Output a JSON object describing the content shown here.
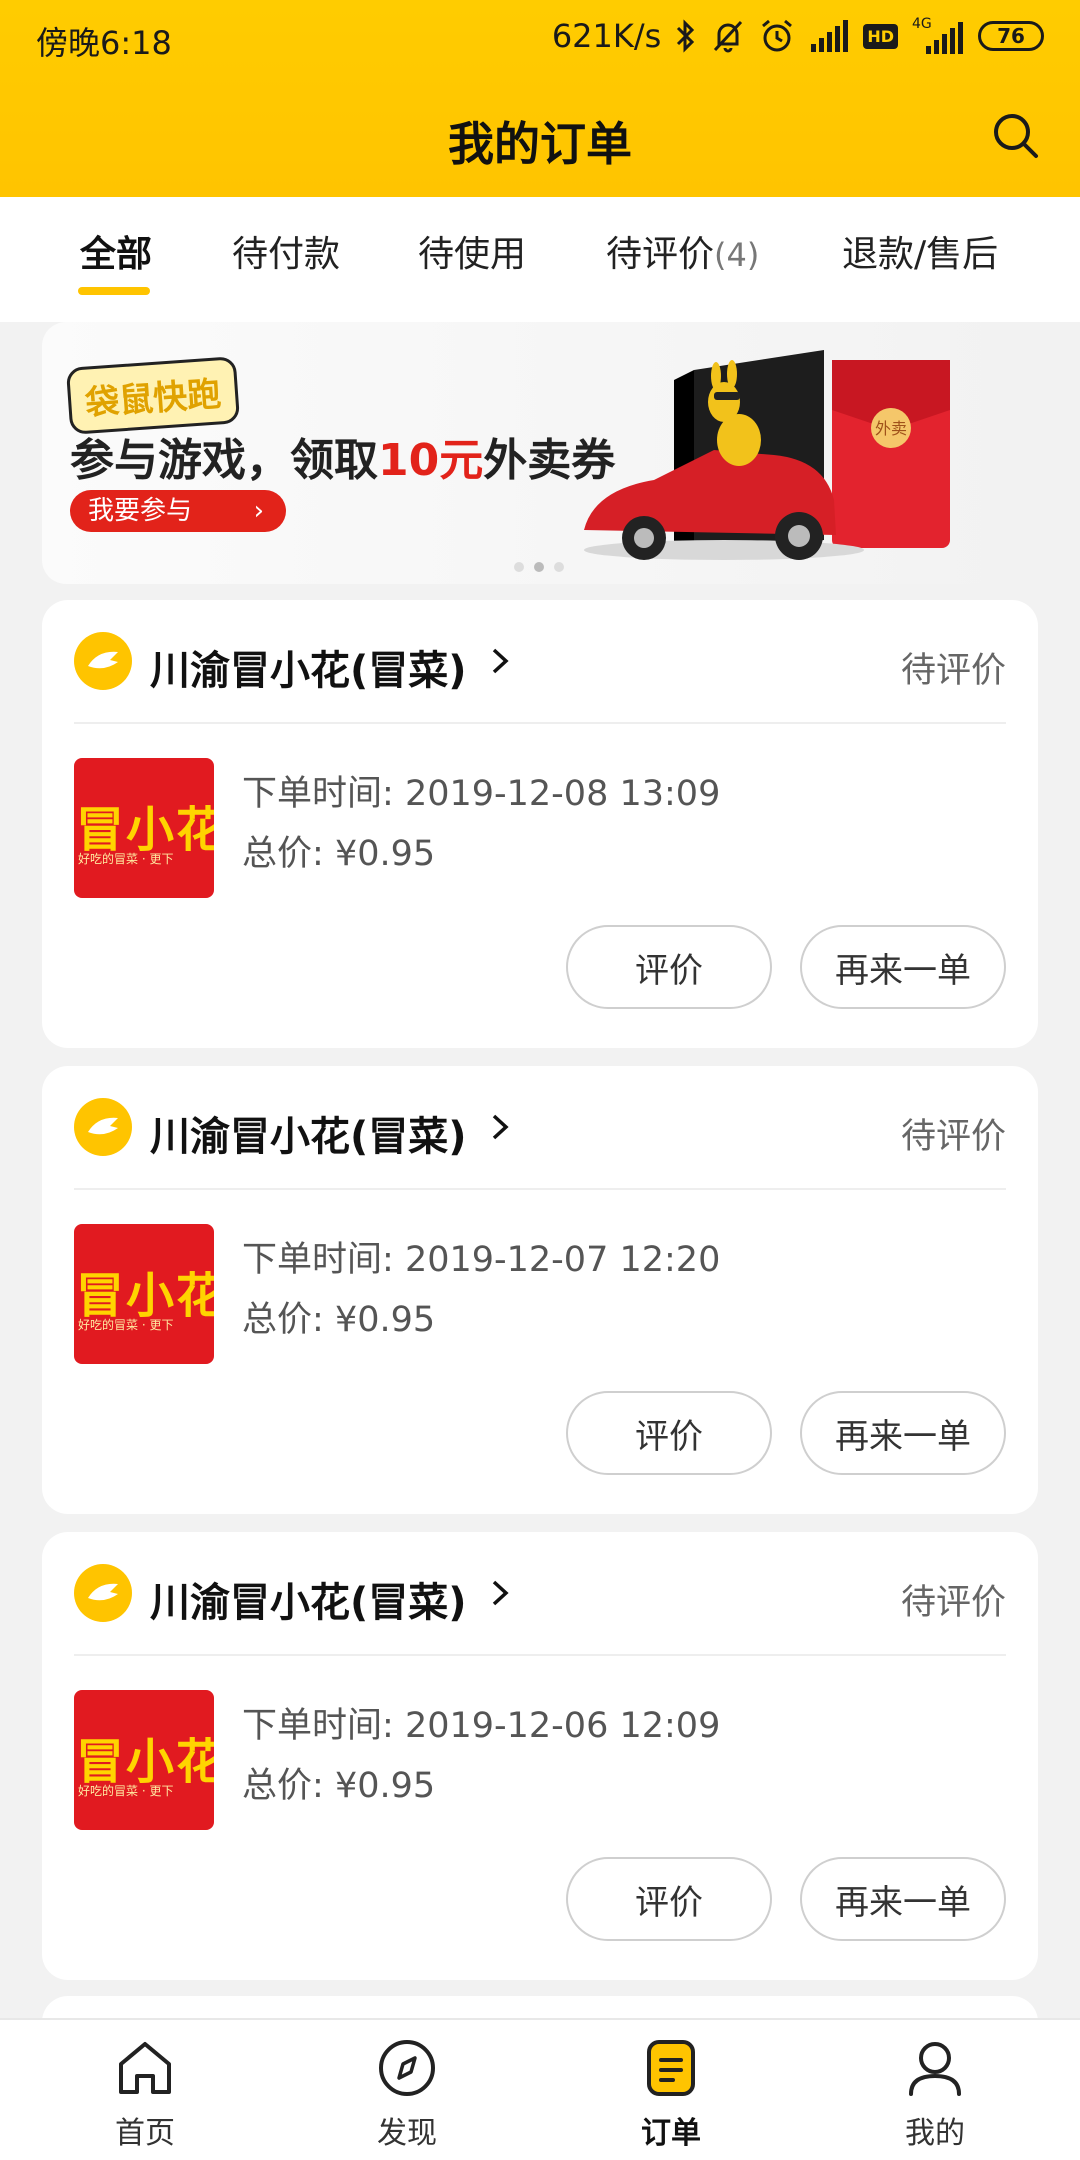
{
  "status_bar": {
    "time": "傍晚6:18",
    "network_speed": "621K/s",
    "hd_label": "HD",
    "network_type": "4G",
    "battery": "76"
  },
  "header": {
    "title": "我的订单",
    "accent_color": "#ffc400"
  },
  "tabs": [
    {
      "label": "全部",
      "active": true
    },
    {
      "label": "待付款"
    },
    {
      "label": "待使用"
    },
    {
      "label": "待评价",
      "count": "(4)"
    },
    {
      "label": "退款/售后"
    }
  ],
  "banner": {
    "logo_text": "袋鼠快跑",
    "text_before": "参与游戏，领取",
    "text_highlight": "10元",
    "text_after": "外卖券",
    "button_label": "我要参与",
    "button_arrow": "›",
    "envelope_text": "外卖"
  },
  "orders": [
    {
      "shop_name": "川渝冒小花(冒菜)",
      "status": "待评价",
      "thumb_text": "冒小花",
      "thumb_sub": "好吃的冒菜 · 更下",
      "time_label": "下单时间:",
      "time": "2019-12-08 13:09",
      "price_label": "总价:",
      "price": "¥0.95",
      "review_label": "评价",
      "reorder_label": "再来一单"
    },
    {
      "shop_name": "川渝冒小花(冒菜)",
      "status": "待评价",
      "thumb_text": "冒小花",
      "thumb_sub": "好吃的冒菜 · 更下",
      "time_label": "下单时间:",
      "time": "2019-12-07 12:20",
      "price_label": "总价:",
      "price": "¥0.95",
      "review_label": "评价",
      "reorder_label": "再来一单"
    },
    {
      "shop_name": "川渝冒小花(冒菜)",
      "status": "待评价",
      "thumb_text": "冒小花",
      "thumb_sub": "好吃的冒菜 · 更下",
      "time_label": "下单时间:",
      "time": "2019-12-06 12:09",
      "price_label": "总价:",
      "price": "¥0.95",
      "review_label": "评价",
      "reorder_label": "再来一单"
    }
  ],
  "bottom_nav": [
    {
      "label": "首页",
      "icon": "home-icon"
    },
    {
      "label": "发现",
      "icon": "compass-icon"
    },
    {
      "label": "订单",
      "icon": "order-icon",
      "active": true
    },
    {
      "label": "我的",
      "icon": "profile-icon"
    }
  ]
}
